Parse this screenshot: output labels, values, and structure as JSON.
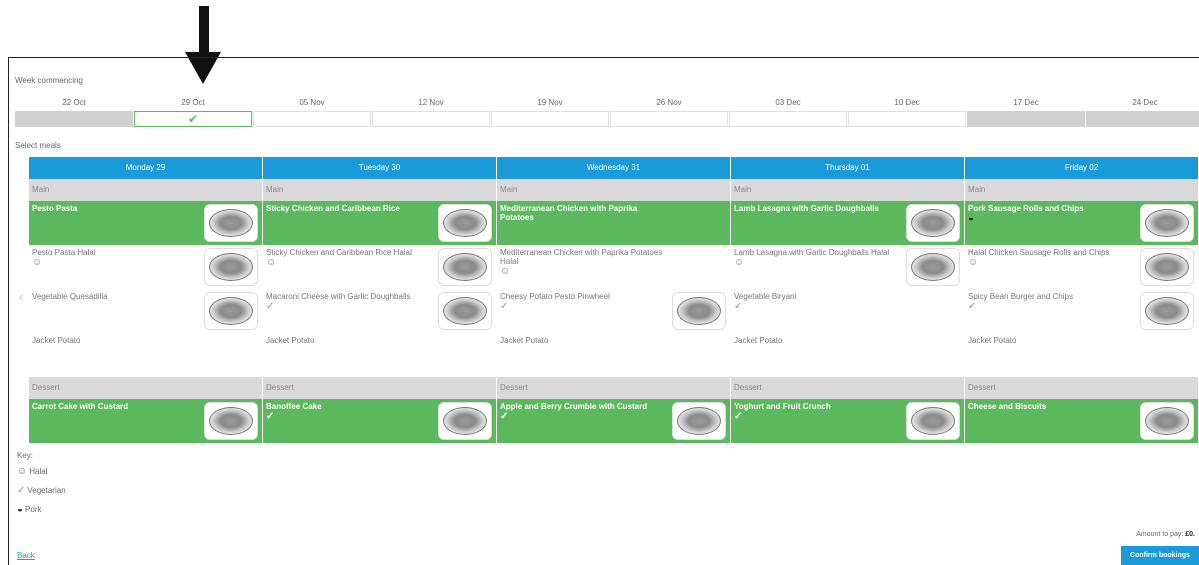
{
  "week_commencing_label": "Week commencing",
  "weeks": [
    {
      "label": "22 Oct",
      "state": "unavailable"
    },
    {
      "label": "29 Oct",
      "state": "selected"
    },
    {
      "label": "05 Nov",
      "state": "available"
    },
    {
      "label": "12 Nov",
      "state": "available"
    },
    {
      "label": "19 Nov",
      "state": "available"
    },
    {
      "label": "26 Nov",
      "state": "available"
    },
    {
      "label": "03 Dec",
      "state": "available"
    },
    {
      "label": "10 Dec",
      "state": "available"
    },
    {
      "label": "17 Dec",
      "state": "unavailable"
    },
    {
      "label": "24 Dec",
      "state": "unavailable"
    }
  ],
  "select_meals_label": "Select meals",
  "main_label": "Main",
  "dessert_label": "Dessert",
  "days": [
    {
      "name": "Monday 29",
      "mains": [
        {
          "name": "Pesto Pasta",
          "selected": true,
          "tag": "",
          "image": true
        },
        {
          "name": "Pesto Pasta Halal",
          "selected": false,
          "tag": "halal",
          "image": true
        },
        {
          "name": "Vegetable Quesadilla",
          "selected": false,
          "tag": "",
          "image": true
        },
        {
          "name": "Jacket Potato",
          "selected": false,
          "tag": "",
          "image": false
        }
      ],
      "dessert": {
        "name": "Carrot Cake with Custard",
        "selected": true,
        "tag": "",
        "image": true
      }
    },
    {
      "name": "Tuesday 30",
      "mains": [
        {
          "name": "Sticky Chicken and Caribbean Rice",
          "selected": true,
          "tag": "",
          "image": true
        },
        {
          "name": "Sticky Chicken and Caribbean Rice Halal",
          "selected": false,
          "tag": "halal",
          "image": true
        },
        {
          "name": "Macaroni Cheese with Garlic Doughballs",
          "selected": false,
          "tag": "vegetarian",
          "image": true
        },
        {
          "name": "Jacket Potato",
          "selected": false,
          "tag": "",
          "image": false
        }
      ],
      "dessert": {
        "name": "Banoffee Cake",
        "selected": true,
        "tag": "vegetarian",
        "image": true
      }
    },
    {
      "name": "Wednesday 31",
      "mains": [
        {
          "name": "Mediterranean Chicken with Paprika Potatoes",
          "selected": true,
          "tag": "",
          "image": false
        },
        {
          "name": "Mediterranean Chicken with Paprika Potatoes Halal",
          "selected": false,
          "tag": "halal",
          "image": false
        },
        {
          "name": "Cheesy Potato Pesto Pinwheel",
          "selected": false,
          "tag": "vegetarian",
          "image": true
        },
        {
          "name": "Jacket Potato",
          "selected": false,
          "tag": "",
          "image": false
        }
      ],
      "dessert": {
        "name": "Apple and Berry Crumble with Custard",
        "selected": true,
        "tag": "vegetarian",
        "image": true
      }
    },
    {
      "name": "Thursday 01",
      "mains": [
        {
          "name": "Lamb Lasagna with Garlic Doughballs",
          "selected": true,
          "tag": "",
          "image": true
        },
        {
          "name": "Lamb Lasagna with Garlic Doughballs Halal",
          "selected": false,
          "tag": "halal",
          "image": true
        },
        {
          "name": "Vegetable Biryani",
          "selected": false,
          "tag": "vegetarian",
          "image": false
        },
        {
          "name": "Jacket Potato",
          "selected": false,
          "tag": "",
          "image": false
        }
      ],
      "dessert": {
        "name": "Yoghurt and Fruit Crunch",
        "selected": true,
        "tag": "vegetarian",
        "image": true
      }
    },
    {
      "name": "Friday 02",
      "mains": [
        {
          "name": "Pork Sausage Rolls and Chips",
          "selected": true,
          "tag": "pork",
          "image": true
        },
        {
          "name": "Halal Chicken Sausage Rolls and Chips",
          "selected": false,
          "tag": "halal",
          "image": true
        },
        {
          "name": "Spicy Bean Burger and Chips",
          "selected": false,
          "tag": "vegetarian",
          "image": true
        },
        {
          "name": "Jacket Potato",
          "selected": false,
          "tag": "",
          "image": false
        }
      ],
      "dessert": {
        "name": "Cheese and Biscuits",
        "selected": true,
        "tag": "",
        "image": true
      }
    }
  ],
  "key": {
    "title": "Key:",
    "halal": "Halal",
    "vegetarian": "Vegetarian",
    "pork": "Pork"
  },
  "tag_icons": {
    "halal": "☺",
    "vegetarian": "✓",
    "pork": "◒"
  },
  "amount_label": "Amount to pay:",
  "amount_value": "£0.",
  "back_label": "Back",
  "confirm_label": "Confirm bookings",
  "colors": {
    "accent_blue": "#1b9ad9",
    "selected_green": "#5cb85c",
    "category_grey": "#d9d9d9"
  },
  "prev_arrow_icon": "‹"
}
